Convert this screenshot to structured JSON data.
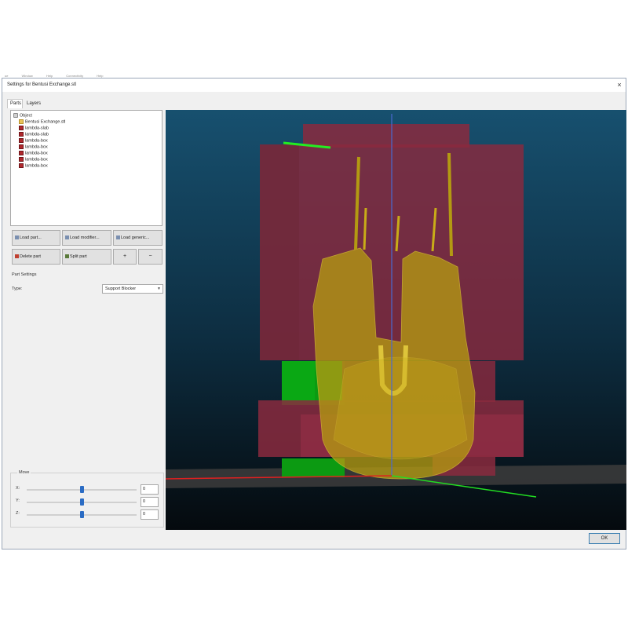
{
  "menubar": [
    "ue",
    "Window",
    "Help",
    "Connectivity",
    "Help"
  ],
  "window": {
    "title": "Settings for Bentusi Exchange.stl",
    "close_glyph": "×"
  },
  "tabs": [
    {
      "label": "Parts"
    },
    {
      "label": "Layers"
    }
  ],
  "tree": {
    "root": "Object",
    "object": "Bentusi Exchange.stl",
    "parts": [
      "lambda-slab",
      "lambda-slab",
      "lambda-box",
      "lambda-box",
      "lambda-box",
      "lambda-box",
      "lambda-box"
    ]
  },
  "buttons": {
    "load_part": "Load part...",
    "load_modifier": "Load modifier...",
    "load_generic": "Load generic...",
    "delete_part": "Delete part",
    "split_part": "Split part",
    "plus": "+",
    "minus": "−"
  },
  "part_settings": {
    "heading": "Part Settings",
    "type_label": "Type:",
    "type_value": "Support Blocker"
  },
  "move": {
    "legend": "Move",
    "axes": [
      {
        "label": "X:",
        "value": "0"
      },
      {
        "label": "Y:",
        "value": "0"
      },
      {
        "label": "Z:",
        "value": "0"
      }
    ]
  },
  "footer": {
    "ok_label": "OK"
  },
  "colors": {
    "viewport_top": "#17506f",
    "viewport_bottom": "#050a0e",
    "blocker_red": "#8a2a3e",
    "model_yellow": "#b39a12",
    "part_green": "#0c9a12"
  }
}
